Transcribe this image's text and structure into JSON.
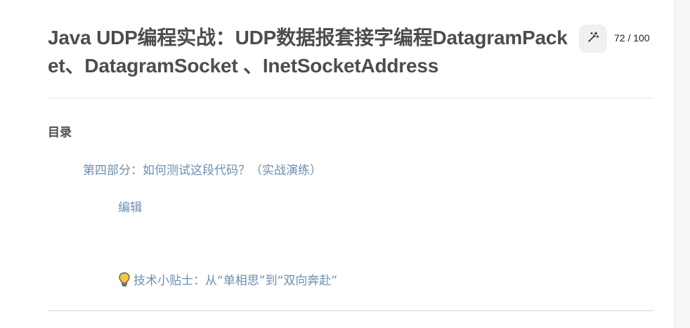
{
  "article": {
    "title": "Java UDP编程实战：UDP数据报套接字编程DatagramPacket、DatagramSocket 、InetSocketAddress",
    "progress": "72 / 100",
    "ai_button_icon": "magic-wand-icon"
  },
  "toc": {
    "heading": "目录",
    "items": [
      {
        "label": "第四部分：如何测试这段代码？（实战演练）"
      },
      {
        "label": "编辑"
      },
      {
        "label": "技术小贴士：从“单相思”到“双向奔赴”",
        "icon": "lightbulb-icon"
      }
    ]
  },
  "colors": {
    "title": "#4d4d4d",
    "toc_link": "#6d8fb0",
    "ai_button_bg": "#f0f0f2"
  }
}
